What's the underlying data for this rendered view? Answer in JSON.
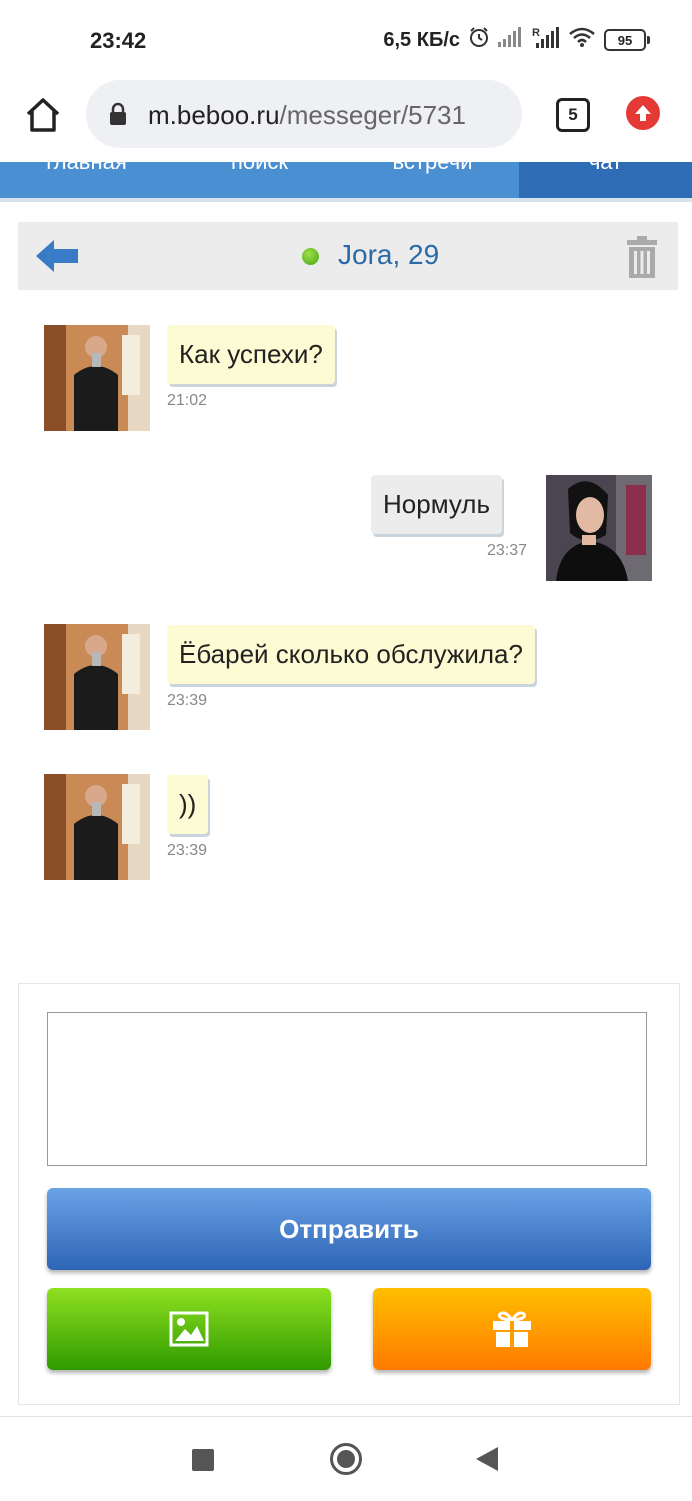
{
  "status_bar": {
    "time": "23:42",
    "network_speed": "6,5 КБ/с",
    "battery": "95",
    "icons": [
      "alarm-icon",
      "signal-icon",
      "signal-roaming-icon",
      "wifi-icon",
      "battery-icon"
    ]
  },
  "browser": {
    "url_host": "m.beboo.ru",
    "url_path": "/messeger/5731",
    "tab_count": "5"
  },
  "site_nav": {
    "tabs": [
      "главная",
      "поиск",
      "встречи",
      "чат"
    ],
    "active_tab": "чат"
  },
  "chat": {
    "partner": "Jora, 29",
    "online": true,
    "messages": [
      {
        "direction": "in",
        "text": "Как успехи?",
        "time": "21:02"
      },
      {
        "direction": "out",
        "text": "Нормуль",
        "time": "23:37"
      },
      {
        "direction": "in",
        "text": "Ёбарей сколько обслужила?",
        "time": "23:39"
      },
      {
        "direction": "in",
        "text": "))",
        "time": "23:39"
      }
    ]
  },
  "composer": {
    "message_value": "",
    "send_label": "Отправить",
    "photo_icon": "image-icon",
    "gift_icon": "gift-icon"
  },
  "colors": {
    "nav_blue": "#4a8fd1",
    "nav_active": "#2e6db5",
    "incoming_bubble": "#fdfbd3",
    "outgoing_bubble": "#ececec",
    "send_button": "#2d64b6",
    "photo_button": "#2f9a00",
    "gift_button": "#ff7a00",
    "online_dot": "#4aa312"
  }
}
